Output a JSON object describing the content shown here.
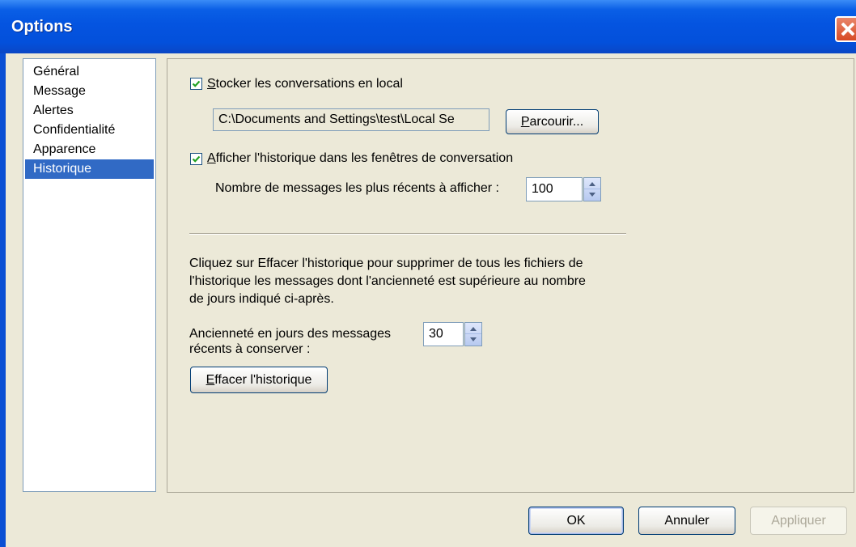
{
  "window": {
    "title": "Options"
  },
  "sidebar": {
    "items": [
      {
        "label": "Général"
      },
      {
        "label": "Message"
      },
      {
        "label": "Alertes"
      },
      {
        "label": "Confidentialité"
      },
      {
        "label": "Apparence"
      },
      {
        "label": "Historique",
        "selected": true
      }
    ]
  },
  "history": {
    "store_local": {
      "checked": true,
      "label_accesskey": "S",
      "label_rest": "tocker les conversations en local"
    },
    "path_value": "C:\\Documents and Settings\\test\\Local Se",
    "browse_button": {
      "accesskey": "P",
      "rest": "arcourir..."
    },
    "show_history": {
      "checked": true,
      "label_accesskey": "A",
      "label_rest": "fficher l'historique dans les fenêtres de conversation"
    },
    "recent_count_label": "Nombre de messages les plus récents à afficher :",
    "recent_count_value": "100",
    "clear_description": [
      "Cliquez sur Effacer l'historique pour supprimer de tous les fichiers de",
      "l'historique les messages dont l'ancienneté est supérieure au nombre",
      "de jours indiqué ci-après."
    ],
    "age_label": [
      "Ancienneté en jours des messages",
      "récents à conserver :"
    ],
    "age_value": "30",
    "clear_button": {
      "accesskey": "E",
      "rest": "ffacer l'historique"
    }
  },
  "footer": {
    "ok_label": "OK",
    "cancel_label": "Annuler",
    "apply_label": "Appliquer"
  }
}
